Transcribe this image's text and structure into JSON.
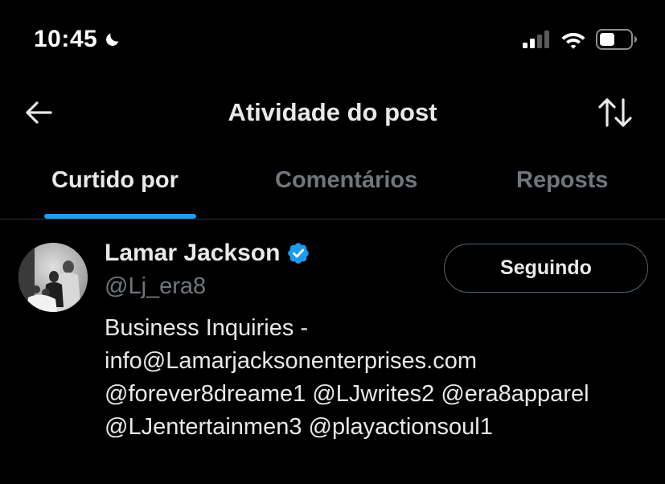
{
  "status_bar": {
    "time": "10:45",
    "icons": [
      "moon-icon",
      "cellular-signal-icon",
      "wifi-icon",
      "battery-icon"
    ]
  },
  "header": {
    "title": "Atividade do post",
    "back_icon": "arrow-left-icon",
    "sort_icon": "sort-arrows-icon"
  },
  "tabs": [
    {
      "label": "Curtido por",
      "active": true
    },
    {
      "label": "Comentários",
      "active": false
    },
    {
      "label": "Reposts",
      "active": false
    }
  ],
  "users": [
    {
      "name": "Lamar Jackson",
      "handle": "@Lj_era8",
      "verified": true,
      "follow_label": "Seguindo",
      "bio_lines": [
        "Business Inquiries -",
        "info@Lamarjacksonenterprises.com",
        "@forever8dreame1 @LJwrites2 @era8apparel",
        "@LJentertainmen3 @playactionsoul1"
      ]
    }
  ],
  "colors": {
    "background": "#000000",
    "text_primary": "#e7e9ea",
    "text_secondary": "#71767b",
    "accent": "#1d9bf0",
    "divider": "#2f3336"
  }
}
